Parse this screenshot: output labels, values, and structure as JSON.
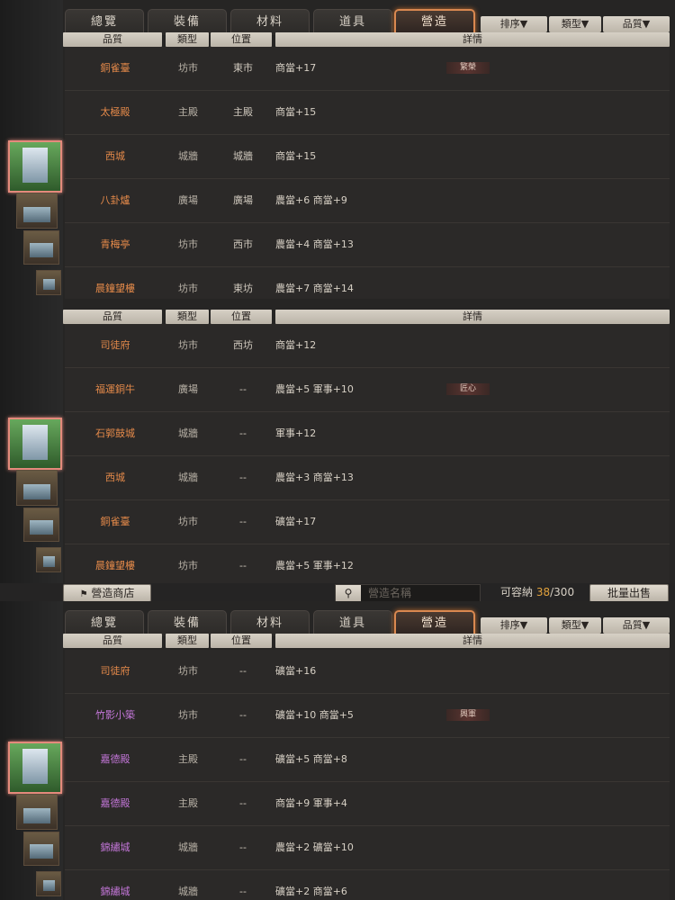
{
  "tabs": [
    "總覽",
    "裝備",
    "材料",
    "道具",
    "營造"
  ],
  "active_tab_index": 4,
  "dropdowns": [
    "排序▼",
    "類型▼",
    "品質▼"
  ],
  "columns": [
    "品質",
    "類型",
    "位置",
    "詳情"
  ],
  "panels": [
    {
      "rows": [
        {
          "name": "銅雀臺",
          "quality": "orange",
          "type": "坊市",
          "location": "東市",
          "detail": "商當+17",
          "tag": "繁榮"
        },
        {
          "name": "太極殿",
          "quality": "orange",
          "type": "主殿",
          "location": "主殿",
          "detail": "商當+15",
          "tag": ""
        },
        {
          "name": "西城",
          "quality": "orange",
          "type": "城牆",
          "location": "城牆",
          "detail": "商當+15",
          "tag": ""
        },
        {
          "name": "八卦爐",
          "quality": "orange",
          "type": "廣場",
          "location": "廣場",
          "detail": "農當+6  商當+9",
          "tag": ""
        },
        {
          "name": "青梅亭",
          "quality": "orange",
          "type": "坊市",
          "location": "西市",
          "detail": "農當+4  商當+13",
          "tag": ""
        },
        {
          "name": "晨鐘望樓",
          "quality": "orange",
          "type": "坊市",
          "location": "東坊",
          "detail": "農當+7  商當+14",
          "tag": ""
        }
      ]
    },
    {
      "rows": [
        {
          "name": "司徒府",
          "quality": "orange",
          "type": "坊市",
          "location": "西坊",
          "detail": "商當+12",
          "tag": ""
        },
        {
          "name": "福運銅牛",
          "quality": "orange",
          "type": "廣場",
          "location": "--",
          "detail": "農當+5  軍事+10",
          "tag": "匠心"
        },
        {
          "name": "石郭鼓城",
          "quality": "orange",
          "type": "城牆",
          "location": "--",
          "detail": "軍事+12",
          "tag": ""
        },
        {
          "name": "西城",
          "quality": "orange",
          "type": "城牆",
          "location": "--",
          "detail": "農當+3  商當+13",
          "tag": ""
        },
        {
          "name": "銅雀臺",
          "quality": "orange",
          "type": "坊市",
          "location": "--",
          "detail": "礦當+17",
          "tag": ""
        },
        {
          "name": "晨鐘望樓",
          "quality": "orange",
          "type": "坊市",
          "location": "--",
          "detail": "農當+5  軍事+12",
          "tag": ""
        }
      ]
    },
    {
      "rows": [
        {
          "name": "司徒府",
          "quality": "orange",
          "type": "坊市",
          "location": "--",
          "detail": "礦當+16",
          "tag": ""
        },
        {
          "name": "竹影小築",
          "quality": "purple",
          "type": "坊市",
          "location": "--",
          "detail": "礦當+10  商當+5",
          "tag": "興軍"
        },
        {
          "name": "嘉德殿",
          "quality": "purple",
          "type": "主殿",
          "location": "--",
          "detail": "礦當+5  商當+8",
          "tag": ""
        },
        {
          "name": "嘉德殿",
          "quality": "purple",
          "type": "主殿",
          "location": "--",
          "detail": "商當+9  軍事+4",
          "tag": ""
        },
        {
          "name": "錦繡城",
          "quality": "purple",
          "type": "城牆",
          "location": "--",
          "detail": "農當+2  礦當+10",
          "tag": ""
        },
        {
          "name": "錦繡城",
          "quality": "purple",
          "type": "城牆",
          "location": "--",
          "detail": "礦當+2  商當+6",
          "tag": ""
        }
      ]
    }
  ],
  "footer": {
    "shop_button": "營造商店",
    "search_placeholder": "營造名稱",
    "capacity_label": "可容納",
    "capacity_used": "38",
    "capacity_total": "/300",
    "sell_button": "批量出售"
  }
}
